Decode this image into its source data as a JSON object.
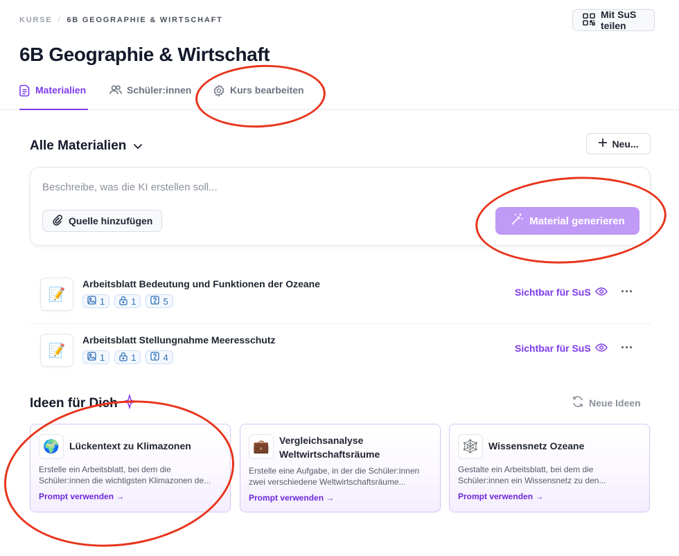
{
  "breadcrumb": {
    "root": "KURSE",
    "separator": "/",
    "current": "6B GEOGRAPHIE & WIRTSCHAFT"
  },
  "share_button": {
    "label": "Mit SuS teilen",
    "icon": "qr-code-icon"
  },
  "page_title": "6B Geographie & Wirtschaft",
  "tabs": [
    {
      "label": "Materialien",
      "icon": "document-icon",
      "active": true
    },
    {
      "label": "Schüler:innen",
      "icon": "users-icon",
      "active": false
    },
    {
      "label": "Kurs bearbeiten",
      "icon": "gear-icon",
      "active": false
    }
  ],
  "materials_section": {
    "title": "Alle Materialien",
    "new_button": "Neu..."
  },
  "ai_box": {
    "placeholder": "Beschreibe, was die KI erstellen soll...",
    "source_button": "Quelle hinzufügen",
    "generate_button": "Material generieren"
  },
  "materials": [
    {
      "title": "Arbeitsblatt Bedeutung und Funktionen der Ozeane",
      "icon": "memo-icon",
      "badges": {
        "images": "1",
        "locked": "1",
        "questions": "5"
      },
      "visibility": "Sichtbar für SuS"
    },
    {
      "title": "Arbeitsblatt Stellungnahme Meeresschutz",
      "icon": "memo-icon",
      "badges": {
        "images": "1",
        "locked": "1",
        "questions": "4"
      },
      "visibility": "Sichtbar für SuS"
    }
  ],
  "ideas": {
    "title": "Ideen für Dich",
    "refresh_button": "Neue Ideen",
    "cards": [
      {
        "title": "Lückentext zu Klimazonen",
        "icon": "globe-icon",
        "description_line1": "Erstelle ein Arbeitsblatt, bei dem die",
        "description_line2": "Schüler:innen die wichtigsten Klimazonen de...",
        "link": "Prompt verwenden →"
      },
      {
        "title_line1": "Vergleichsanalyse",
        "title_line2": "Weltwirtschaftsräume",
        "icon": "briefcase-icon",
        "description_line1": "Erstelle eine Aufgabe, in der die Schüler:innen",
        "description_line2": "zwei verschiedene Weltwirtschaftsräume...",
        "link": "Prompt verwenden →"
      },
      {
        "title": "Wissensnetz Ozeane",
        "icon": "spider-web-icon",
        "description_line1": "Gestalte ein Arbeitsblatt, bei dem die",
        "description_line2": "Schüler:innen ein Wissensnetz zu den...",
        "link": "Prompt verwenden →"
      }
    ]
  },
  "colors": {
    "accent": "#7c3aed",
    "generate_button": "#c19af7",
    "annotation": "#e8341c",
    "badge_text": "#2f6fb5"
  }
}
